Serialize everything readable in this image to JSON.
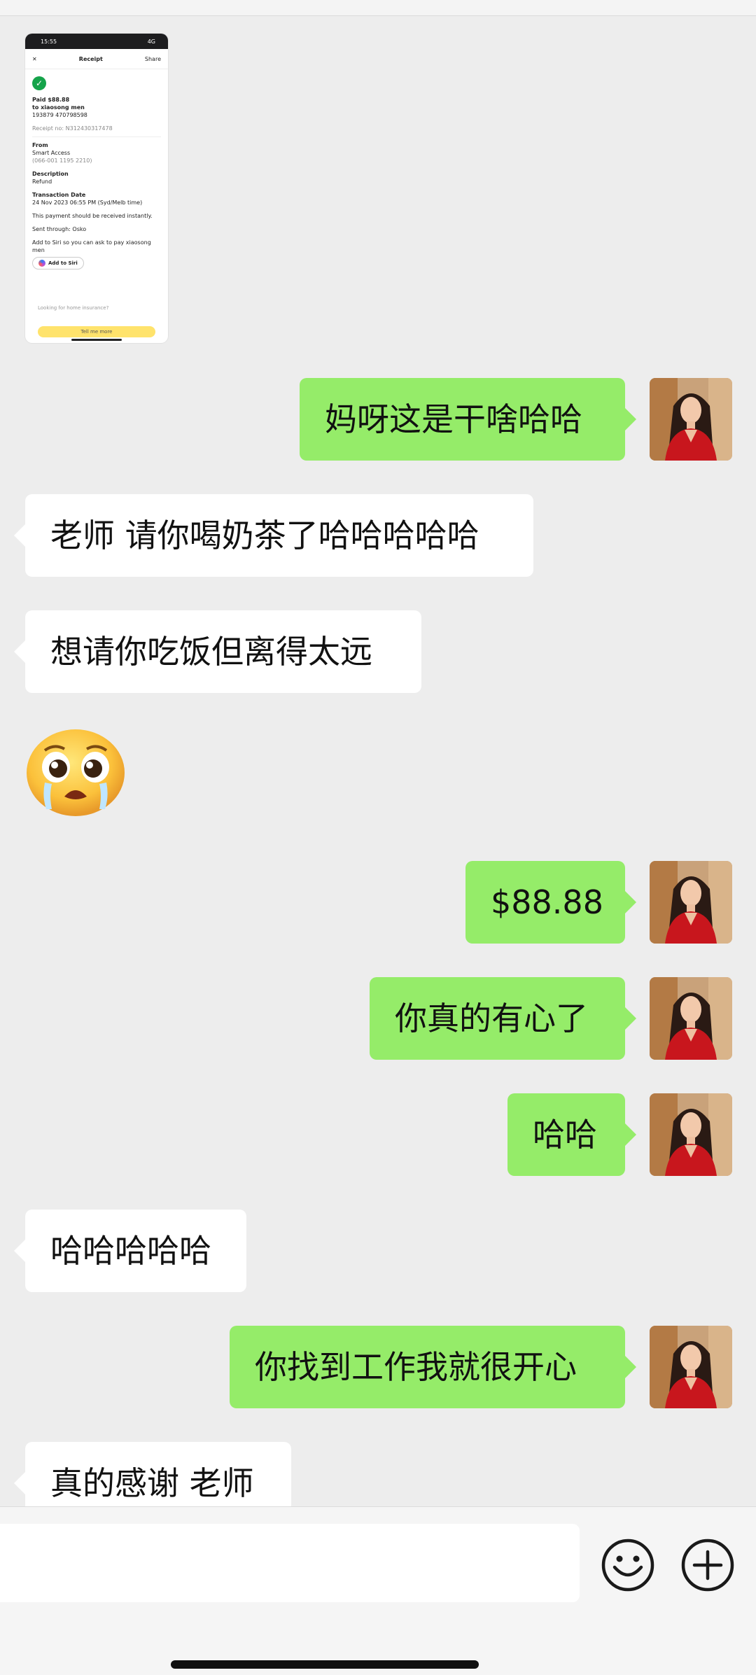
{
  "receipt": {
    "status_time": "15:55",
    "status_right": "4G",
    "close": "✕",
    "title": "Receipt",
    "share": "Share",
    "paid": "Paid $88.88",
    "to": "to xiaosong men",
    "account": "193879 470798598",
    "receipt_no": "Receipt no: N312430317478",
    "from_label": "From",
    "from_value": "Smart Access",
    "from_account": "(066-001 1195 2210)",
    "description_label": "Description",
    "description_value": "Refund",
    "date_label": "Transaction Date",
    "date_value": "24 Nov 2023 06:55 PM (Syd/Melb time)",
    "instant_note": "This payment should be received instantly.",
    "sent_through": "Sent through: Osko",
    "siri_note": "Add to Siri so you can ask to pay xiaosong men",
    "siri_button": "Add to Siri",
    "promo": "Looking for home insurance?",
    "tell_me_more": "Tell me more"
  },
  "messages": [
    {
      "side": "out",
      "text": "妈呀这是干啥哈哈"
    },
    {
      "side": "in",
      "text": "老师 请你喝奶茶了哈哈哈哈哈"
    },
    {
      "side": "in",
      "text": "想请你吃饭但离得太远"
    },
    {
      "side": "in",
      "sticker": "crying-face-sticker"
    },
    {
      "side": "out",
      "text": "$88.88"
    },
    {
      "side": "out",
      "text": "你真的有心了"
    },
    {
      "side": "out",
      "text": "哈哈"
    },
    {
      "side": "in",
      "text": "哈哈哈哈哈"
    },
    {
      "side": "out",
      "text": "你找到工作我就很开心"
    },
    {
      "side": "in",
      "text": "真的感谢 老师"
    }
  ],
  "input": {
    "text_field_value": "",
    "emoji_icon": "smiley-icon",
    "plus_icon": "plus-circle-icon"
  },
  "colors": {
    "background": "#ededed",
    "outgoing_bubble": "#95ec69",
    "incoming_bubble": "#ffffff",
    "receipt_button": "#ffe36c"
  }
}
